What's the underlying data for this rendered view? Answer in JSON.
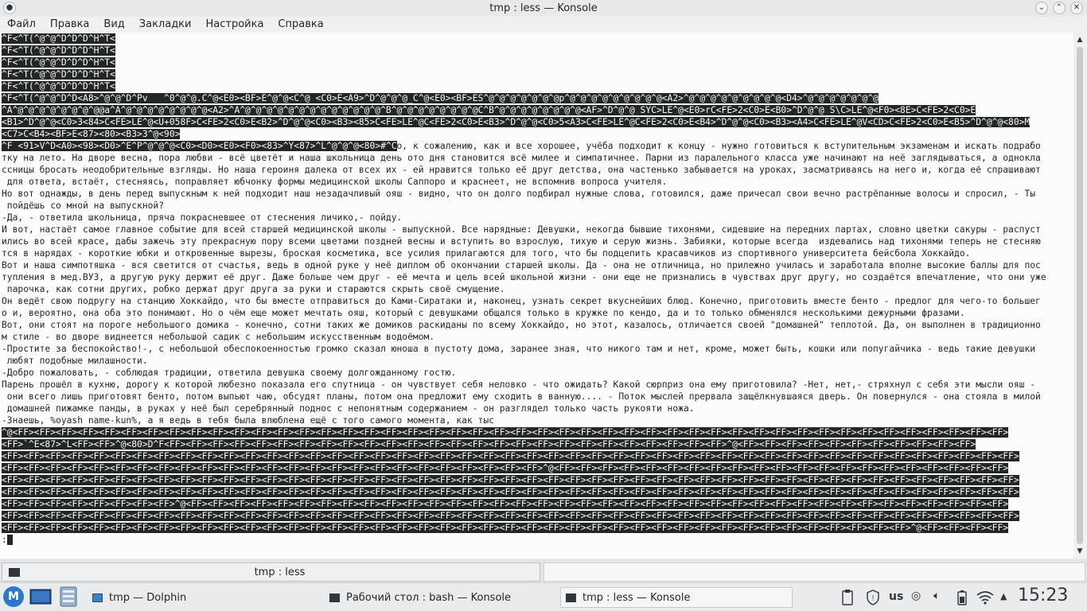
{
  "window": {
    "title": "tmp : less — Konsole",
    "controls": {
      "menu": "●",
      "minimize": "⌄",
      "maximize": "⌃",
      "close": "✕"
    }
  },
  "menubar": {
    "items": [
      "Файл",
      "Правка",
      "Вид",
      "Закладки",
      "Настройка",
      "Справка"
    ]
  },
  "terminal": {
    "lines": [
      [
        [
          "^F<^T(^@^@^D^D^D^H^T<",
          true
        ]
      ],
      [
        [
          "^F<^T(^@^@^D^D^D^H^T<",
          true
        ]
      ],
      [
        [
          "^F<^T(^@^@^D^D^D^H^T<",
          true
        ]
      ],
      [
        [
          "^F<^T(^@^@^D^D^D^H^T<",
          true
        ]
      ],
      [
        [
          "^F<^T(^@^@^D^D^D^H^T<",
          true
        ]
      ],
      [
        [
          "^F<^T(^@^@^D^D<A8>^@^@^D^Pv   ^0^@^@.C^@<E0><BF>E^@^@<C^@ <C0>E<A9>^D^@^@^@_C^@<E0><BF>ES^@^@^@^@^@^@^@p^@^@^@^@^@^@^@^@^@<A2>^@^@^@^@^@^@^@^@^@<D4>^@^@^@^@^@^@^@",
          true
        ]
      ],
      [
        [
          "^A^@^@^@^@^@^@^@^@@a^A^@^@^@^@^@^@^@^@<A2>^A^@^@^@^@^@^@^@^@^@^@^@^@^@^B^@^@^@^@^@^@^@^@C^B^@^@^@^@^@^@^@^@<AF>^D^@^@ SYC>LE^@<E0>rC<FE>2<C0>E<B0>^D^@^@ S\\C>LE^@<F0><8E>C<FE>2<C0>E",
          true
        ]
      ],
      [
        [
          "<B1>^D^@^@<C0>3<84>C<FE>LE^@<U+058F>C<FE>2<C0>E<B2>^D^@^@<C0><B3><85>C<FE>LE^@C<FE>2<C0>E<B3>^D^@^@<C0>5<A3>C<FE>LE^@C<FE>2<C0>E<B4>^D^@^@<C0><B3><A4>C<FE>LE^@V<CD>C<FE>2<C0>E<B5>^D^@^@<80>M",
          true
        ]
      ],
      [
        [
          "<C7>C<B4><BF>E<87><80><B3>3^@<90>",
          true
        ]
      ],
      [
        [
          "^F <91>V^D<A0><98><D0>^E^P^@^@^@<C0><D0><E0><F0><83>^Y<87>^L^@^@^@<80>#^C",
          true
        ],
        [
          "о, к сожалению, как и все хорошее, учёба подходит к концу - нужно готовиться к вступительным экзаменам и искать подрабо",
          false
        ]
      ],
      [
        [
          "тку на лето. На дворе весна, пора любви - всё цветёт и наша школьница день ото дня становится всё милее и симпатичнее. Парни из паралельного класса уже начинают на неё заглядываться, а однокла",
          false
        ]
      ],
      [
        [
          "ссницы бросать неодобрительные взгляды. Но наша героиня далека от всех их - ей нравится только её друг детства, она частенько забывается на уроках, засматриваясь на него и, когда её спрашивают",
          false
        ]
      ],
      [
        [
          " для ответа, встаёт, стесняясь, поправляет юбчонку формы медицинской школы Саппоро и краснеет, не вспомнив вопроса учителя.",
          false
        ]
      ],
      [
        [
          "Но вот однажды, в день перед выпускным к ней подходит наш незадачливый ояш - видно, что он долго подбирал нужные слова, готовился, даже причесал свои вечно растрёпанные волосы и спросил, - Ты",
          false
        ]
      ],
      [
        [
          " пойдёшь со мной на выпускной?",
          false
        ]
      ],
      [
        [
          "-Да, - ответила школьница, пряча покрасневшее от стеснения личико,- пойду.",
          false
        ]
      ],
      [
        [
          "И вот, настаёт самое главное событие для всей старшей медицинской школы - выпускной. Все нарядные: Девушки, некогда бывшие тихонями, сидевшие на передних партах, словно цветки сакуры - распуст",
          false
        ]
      ],
      [
        [
          "ились во всей красе, дабы зажечь эту прекрасную пору всеми цветами поздней весны и вступить во взрослую, тихую и серую жизнь. Забияки, которые всегда  издевались над тихонями теперь не стесняю",
          false
        ]
      ],
      [
        [
          "тся в нарядах - короткие юбки и откровенные вырезы, броская косметика, все усилия прилагаются для того, что бы подцепить красавчиков из спортивного университета бейсбола Хоккайдо.",
          false
        ]
      ],
      [
        [
          "Вот и наша симпотяшка - вся светится от счастья, ведь в одной руке у неё диплом об окончании старшей школы. Да - она не отличница, но прилежно училась и заработала вполне высокие баллы для пос",
          false
        ]
      ],
      [
        [
          "тупления в мед.ВУЗ, а другую руку держит её друг. Даже больше чем друг - её мечта и цель всей школьной жизни - они еще не признались в чувствах друг другу, но создаётся впечатление, что они уже",
          false
        ]
      ],
      [
        [
          " парочка, как сотни других, робко держат друг друга за руки и стараются скрыть своё смущение.",
          false
        ]
      ],
      [
        [
          "Он ведёт свою подругу на станцию Хоккайдо, что бы вместе отправиться до Ками-Сиратаки и, наконец, узнать секрет вкуснейших блюд. Конечно, приготовить вместе бенто - предлог для чего-то большег",
          false
        ]
      ],
      [
        [
          "о и, вероятно, она оба это понимают. Но о чём еще может мечтать ояш, который с девушками общался только в кружке по кендо, да и то только обменялся несколькими дежурными фразами.",
          false
        ]
      ],
      [
        [
          "Вот, они стоят на пороге небольшого домика - конечно, сотни таких же домиков раскиданы по всему Хоккайдо, но этот, казалось, отличается своей \"домашней\" теплотой. Да, он выполнен в традиционно",
          false
        ]
      ],
      [
        [
          "м стиле - во дворе виднеется небольшой садик с небольшим искусственным водоёмом.",
          false
        ]
      ],
      [
        [
          "-Простите за беспокойство!-, с небольшой обеспокоенностью громко сказал юноша в пустоту дома, заранее зная, что никого там и нет, кроме, может быть, кошки или попугайчика - ведь такие девушки",
          false
        ]
      ],
      [
        [
          " любят подобные милашности.",
          false
        ]
      ],
      [
        [
          "-Добро пожаловать, - соблюдая традиции, ответила девушка своему долгожданному гостю.",
          false
        ]
      ],
      [
        [
          "Парень прошёл в кухню, дорогу к которой любезно показала его спутница - он чувствует себя неловко - что ожидать? Какой сюрприз она ему приготовила? -Нет, нет,- стряхнул с себя эти мысли ояш -",
          false
        ]
      ],
      [
        [
          " они всего лишь приготовят бенто, потом выпьют чаю, обсудят планы, потом она предложит ему сходить в ванную.... - Поток мыслей прервала защёлкнувшаяся дверь. Он повернулся - она стояла в милой",
          false
        ]
      ],
      [
        [
          " домашней пижамке панды, в руках у неё был серебрянный поднос с непонятным содержанием - он разглядел только часть рукояти ножа.",
          false
        ]
      ],
      [
        [
          "-Знаешь, %oyash name-kun%, а я ведь в тебя была влюблена ещё с того самого момента, как тыс",
          false
        ]
      ],
      [
        [
          "^@<FF><FF><FF><FF><FF><FF><FF><FF><FF><FF><FF><FF><FF><FF><FF><FF><FF><FF><FF><FF><FF><FF><FF><FF><FF><FF><FF><FF><FF><FF><FF><FF><FF><FF><FF><FF><FF><FF><FF><FF><FF><FF><FF><FF><FF><FF>",
          true
        ]
      ],
      [
        [
          "<FF>`^E<87>^L<FF><FF>^@<80>D^F<FF><FF><FF><FF><FF><FF><FF><FF><FF><FF><FF><FF><FF><FF><FF><FF><FF><FF><FF><FF><FF><FF><FF><FF><FF><FF>^@<FF><FF><FF><FF><FF><FF><FF><FF><FF><FF><FF>",
          true
        ]
      ],
      [
        [
          "<FF><FF><FF><FF><FF><FF><FF><FF><FF><FF><FF><FF><FF><FF><FF><FF><FF><FF><FF><FF><FF><FF><FF><FF><FF><FF><FF><FF><FF><FF><FF><FF><FF><FF><FF><FF><FF><FF><FF><FF><FF><FF><FF><FF><FF><FF><FF>",
          true
        ]
      ],
      [
        [
          "<FF><FF><FF><FF><FF><FF><FF><FF><FF><FF><FF><FF><FF><FF><FF><FF><FF><FF><FF><FF><FF><FF><FF><FF><FF>^@<FF><FF><FF><FF><FF><FF><FF><FF><FF><FF><FF><FF><FF><FF><FF><FF><FF><FF><FF><FF><FF>",
          true
        ]
      ],
      [
        [
          "<FF><FF><FF><FF><FF><FF><FF><FF><FF><FF><FF><FF><FF><FF><FF><FF><FF><FF><FF><FF><FF><FF><FF><FF><FF><FF><FF><FF><FF><FF><FF><FF><FF><FF><FF><FF><FF><FF><FF><FF><FF><FF><FF><FF><FF><FF><FF>",
          true
        ]
      ],
      [
        [
          "<FF><FF><FF><FF><FF><FF><FF><FF><FF><FF><FF><FF><FF><FF><FF><FF><FF><FF><FF><FF><FF><FF><FF><FF><FF><FF><FF><FF><FF><FF><FF><FF><FF><FF><FF><FF><FF><FF><FF><FF><FF><FF><FF><FF><FF><FF><FF>",
          true
        ]
      ],
      [
        [
          "<FF><FF><FF><FF><FF><FF><FF><FF>^@<FF><FF><FF><FF><FF><FF><FF><FF><FF><FF><FF><FF><FF><FF><FF><FF><FF><FF><FF><FF><FF><FF><FF><FF><FF><FF><FF><FF><FF><FF><FF><FF><FF><FF><FF><FF><FF><FF>",
          true
        ]
      ],
      [
        [
          "<FF><FF><FF><FF><FF><FF><FF><FF><FF><FF><FF><FF><FF><FF><FF><FF><FF><FF><FF><FF><FF><FF><FF><FF><FF><FF><FF><FF><FF><FF><FF><FF><FF><FF><FF><FF><FF><FF><FF><FF><FF><FF><FF><FF><FF><FF><FF>",
          true
        ]
      ],
      [
        [
          "<FF><FF><FF><FF><FF><FF><FF><FF><FF><FF><FF><FF><FF><FF><FF><FF><FF><FF><FF><FF><FF><FF><FF><FF><FF><FF><FF><FF><FF><FF><FF><FF><FF><FF><FF><FF><FF><FF><FF><FF><FF><FF>^@<FF><FF><FF><FF>",
          true
        ]
      ],
      [
        [
          ":",
          false
        ],
        [
          " ",
          true
        ]
      ]
    ]
  },
  "tabs": {
    "active_label": "tmp : less"
  },
  "taskbar": {
    "tasks": [
      {
        "label": "tmp — Dolphin"
      },
      {
        "label": "Рабочий стол : bash — Konsole"
      },
      {
        "label": "tmp : less — Konsole"
      }
    ],
    "keyboard_layout": "us",
    "clock": "15:23"
  }
}
